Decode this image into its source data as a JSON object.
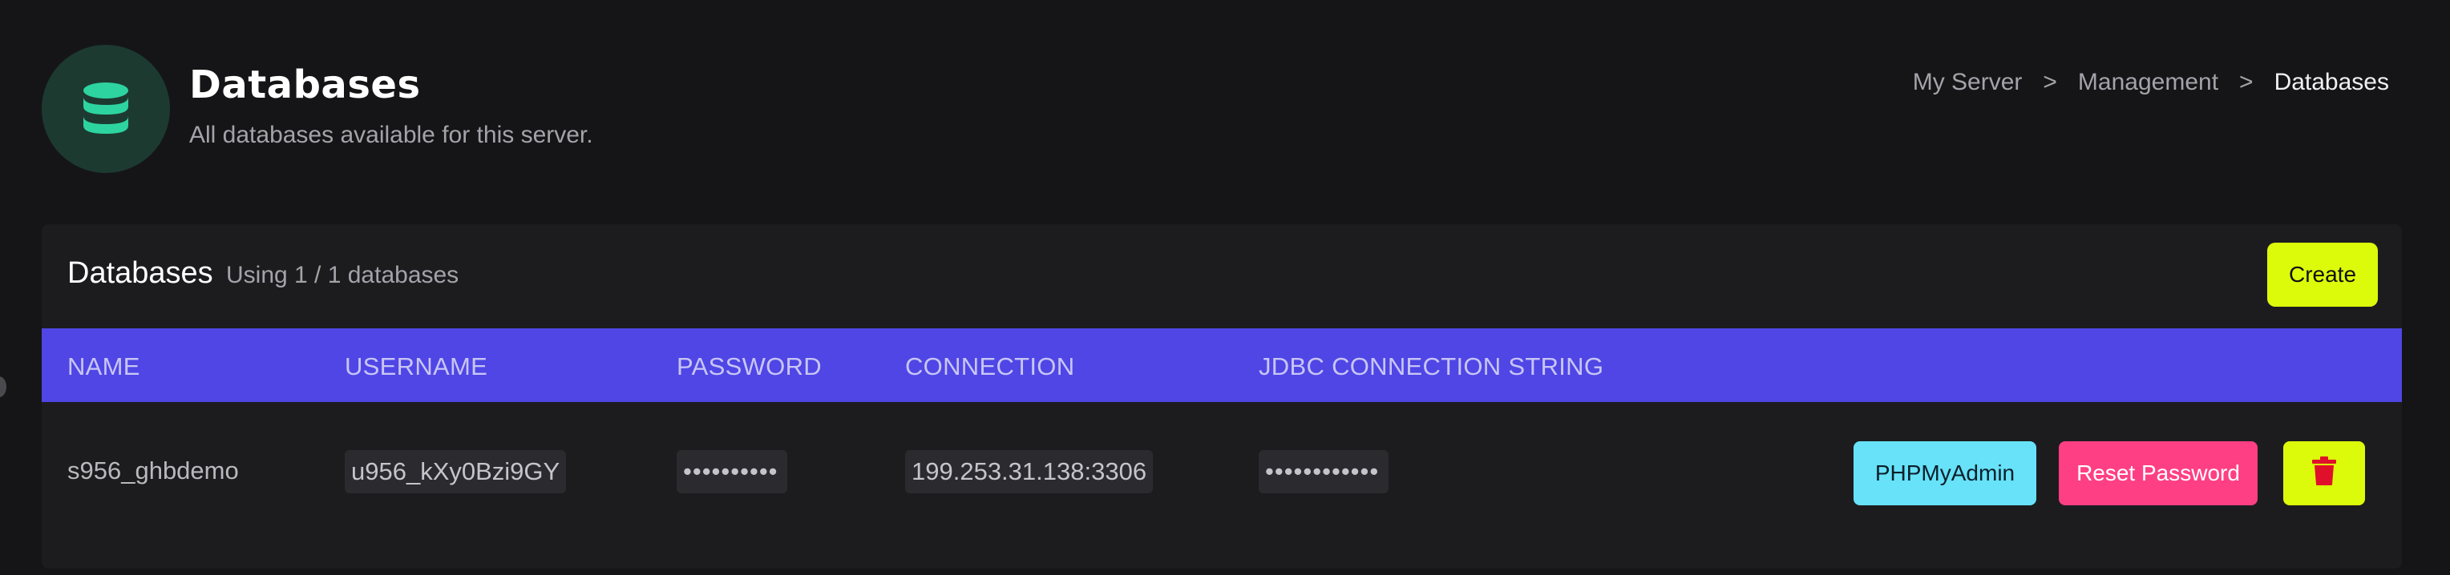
{
  "header": {
    "icon": "database-icon",
    "title": "Databases",
    "subtitle": "All databases available for this server."
  },
  "breadcrumb": {
    "items": [
      "My Server",
      "Management",
      "Databases"
    ],
    "separator": ">"
  },
  "card": {
    "title": "Databases",
    "usage": "Using 1 / 1 databases",
    "create_label": "Create"
  },
  "table": {
    "headers": [
      "NAME",
      "USERNAME",
      "PASSWORD",
      "CONNECTION",
      "JDBC CONNECTION STRING"
    ],
    "rows": [
      {
        "name": "s956_ghbdemo",
        "username": "u956_kXy0Bzi9GY",
        "password": "••••••••••",
        "connection": "199.253.31.138:3306",
        "jdbc": "••••••••••••",
        "phpmyadmin_label": "PHPMyAdmin",
        "reset_label": "Reset Password",
        "delete_icon": "trash-icon"
      }
    ]
  },
  "colors": {
    "background": "#151517",
    "card": "#1c1c1f",
    "table_header": "#4f46e5",
    "accent_lime": "#dcfb0a",
    "accent_cyan": "#67e2f9",
    "accent_pink": "#ff3f84",
    "icon_green": "#2dd4a0",
    "delete_red": "#e0102a"
  }
}
